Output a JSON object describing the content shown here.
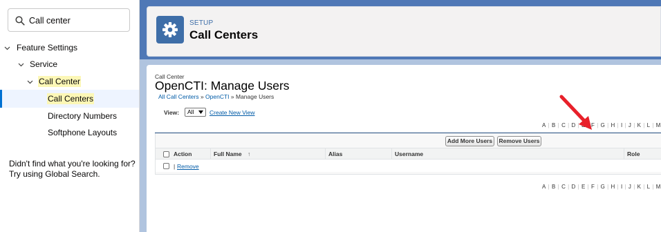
{
  "sidebar": {
    "search_value": "Call center",
    "tree": [
      {
        "label": "Feature Settings",
        "highlight": ""
      },
      {
        "label": "Service",
        "highlight": ""
      },
      {
        "label": "Call Center",
        "highlight": "Call Center"
      },
      {
        "label": "Call Centers",
        "highlight": "Call Center"
      },
      {
        "label": "Directory Numbers"
      },
      {
        "label": "Softphone Layouts"
      }
    ],
    "not_found_line1": "Didn't find what you're looking for?",
    "not_found_line2": "Try using Global Search."
  },
  "header": {
    "kicker": "SETUP",
    "title": "Call Centers",
    "icon": "gear-icon"
  },
  "content": {
    "kicker": "Call Center",
    "title": "OpenCTI: Manage Users",
    "breadcrumb": {
      "all": "All Call Centers",
      "sep": " » ",
      "open_cti": "OpenCTI",
      "current": "Manage Users"
    },
    "view_label": "View:",
    "view_value": "All",
    "create_new_view": "Create New View",
    "alphabet": [
      "A",
      "B",
      "C",
      "D",
      "E",
      "F",
      "G",
      "H",
      "I",
      "J",
      "K",
      "L",
      "M"
    ],
    "buttons": {
      "add_more_users": "Add More Users",
      "remove_users": "Remove Users"
    },
    "columns": {
      "action": "Action",
      "full_name": "Full Name",
      "sort_indicator": "↑",
      "alias": "Alias",
      "username": "Username",
      "role": "Role"
    },
    "row": {
      "separator": "|",
      "remove": "Remove"
    }
  },
  "colors": {
    "header_bar": "#4f78b6",
    "accent": "#0070d2",
    "highlight": "#fcf7b6",
    "arrow": "#e8202a"
  }
}
